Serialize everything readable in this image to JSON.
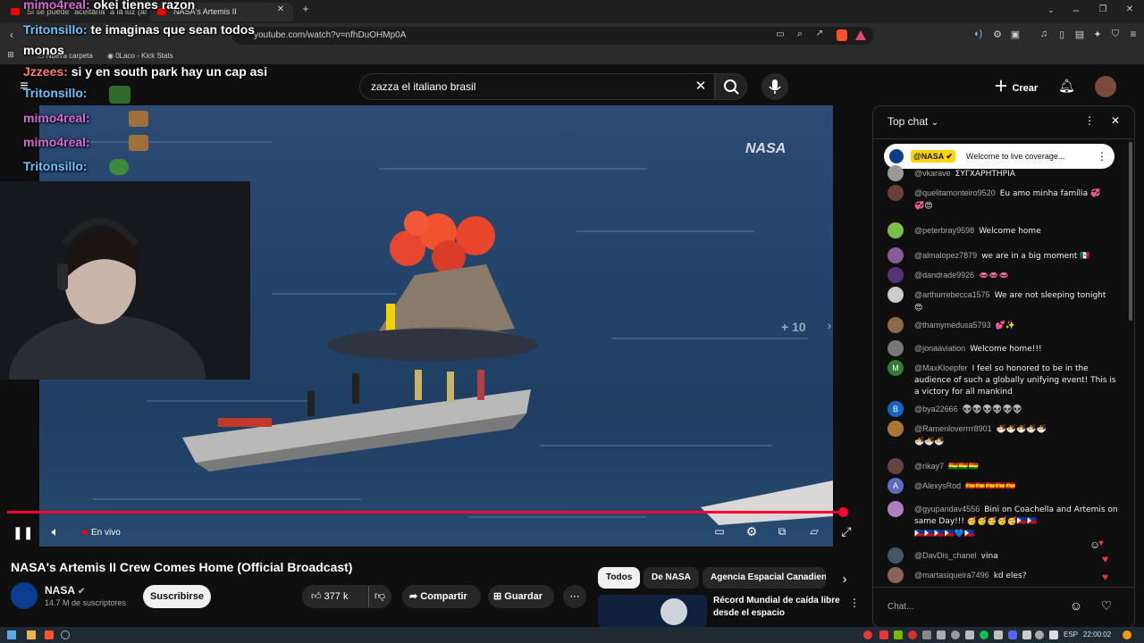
{
  "browser": {
    "tabs": [
      {
        "label": "Si se puede \"aceitarla\" a la luz (así"
      },
      {
        "label": "NASA's Artemis II"
      }
    ],
    "url": "youtube.com/watch?v=nfhDuOHMp0A",
    "bookmarks": [
      "Nueva carpeta",
      "0Laco - Kick Stats"
    ]
  },
  "header": {
    "search_query": "zazza el italiano brasil",
    "create_label": "Crear"
  },
  "overlay_chat": [
    {
      "user": "mimo4real:",
      "text": " okei tienes razon"
    },
    {
      "user": "Tritonsillo:",
      "text": " te imaginas que sean todos"
    },
    {
      "user": "",
      "text": "monos"
    },
    {
      "user": "Jzzees:",
      "text": " si y en south park hay un cap asi"
    },
    {
      "user": "Tritonsillo:",
      "text": ""
    },
    {
      "user": "mimo4real:",
      "text": ""
    },
    {
      "user": "mimo4real:",
      "text": ""
    },
    {
      "user": "Tritonsillo:",
      "text": ""
    }
  ],
  "player": {
    "watermark": "NASA",
    "skip_label": "+ 10",
    "live_label": "En vivo",
    "progress": 1.0
  },
  "video": {
    "title": "NASA's Artemis II Crew Comes Home (Official Broadcast)",
    "channel": "NASA",
    "subscribers": "14.7 M de suscriptores",
    "subscribe_label": "Suscribirse",
    "likes": "377 k",
    "share_label": "Compartir",
    "save_label": "Guardar"
  },
  "chips": [
    "Todos",
    "De NASA",
    "Agencia Espacial Canadiense"
  ],
  "recommended": {
    "title": "Récord Mundial de caída libre desde el espacio"
  },
  "chat": {
    "header": "Top chat",
    "pinned_author": "@NASA",
    "pinned_text": "Welcome to live coverage...",
    "input_placeholder": "Chat...",
    "messages": [
      {
        "author": "@vkarave",
        "text": "ΣΥΓΧΑΡΗΤΗΡΙΑ",
        "color": "#999999"
      },
      {
        "author": "@quelitamonteiro9520",
        "text": "Eu amo minha família 💞",
        "extra": "💞😍",
        "color": "#6a3e3e"
      },
      {
        "author": "@peterbray9598",
        "text": "Welcome home",
        "color": "#7bbf4a"
      },
      {
        "author": "@almalopez7879",
        "text": "we are in a big moment 🇲🇽",
        "color": "#8a5a9a"
      },
      {
        "author": "@dandrade9926",
        "text": "👄👄👄",
        "color": "#553377"
      },
      {
        "author": "@arthurrebecca1575",
        "text": "We are not sleeping tonight",
        "extra": "😍",
        "color": "#cccccc"
      },
      {
        "author": "@thamymedusa5793",
        "text": "💕✨",
        "color": "#8a6a4a"
      },
      {
        "author": "@jonaaviation",
        "text": "Welcome home!!!",
        "color": "#777777"
      },
      {
        "author": "@MaxKloepfer",
        "text": "I feel so honored to be in the audience of such a globally unifying event! This is a victory for all mankind",
        "initial": "M",
        "color": "#2e7d32"
      },
      {
        "author": "@bya22666",
        "text": "👽👽👽👽👽👽",
        "initial": "B",
        "color": "#1565c0"
      },
      {
        "author": "@Ramenloverrrr8901",
        "text": "🍜🍜🍜🍜🍜",
        "extra": "🍜🍜🍜",
        "color": "#aa7733"
      },
      {
        "author": "@rikay7",
        "text": "🇧🇴🇧🇴🇧🇴",
        "color": "#664444"
      },
      {
        "author": "@AlexysRod",
        "text": "🇪🇸🇪🇸🇪🇸🇪🇸🇪🇸",
        "initial": "A",
        "color": "#5c6bc0"
      },
      {
        "author": "@gyupandav4556",
        "text": "Bini on Coachella and Artemis on same Day!!! 🥳🥳🥳🥳🥳🇵🇭🇵🇭",
        "extra": "🇵🇭🇵🇭🇵🇭🇵🇭💙🇵🇭",
        "color": "#b07fc0"
      },
      {
        "author": "@DavDis_chanel",
        "text": "vina",
        "color": "#445566"
      },
      {
        "author": "@martasiqueira7496",
        "text": "kd eles?",
        "color": "#886655"
      }
    ]
  },
  "taskbar": {
    "lang": "ESP",
    "time": "22:00:02"
  },
  "colors": {
    "accent": "#ff0033",
    "bg": "#0f0f0f"
  }
}
